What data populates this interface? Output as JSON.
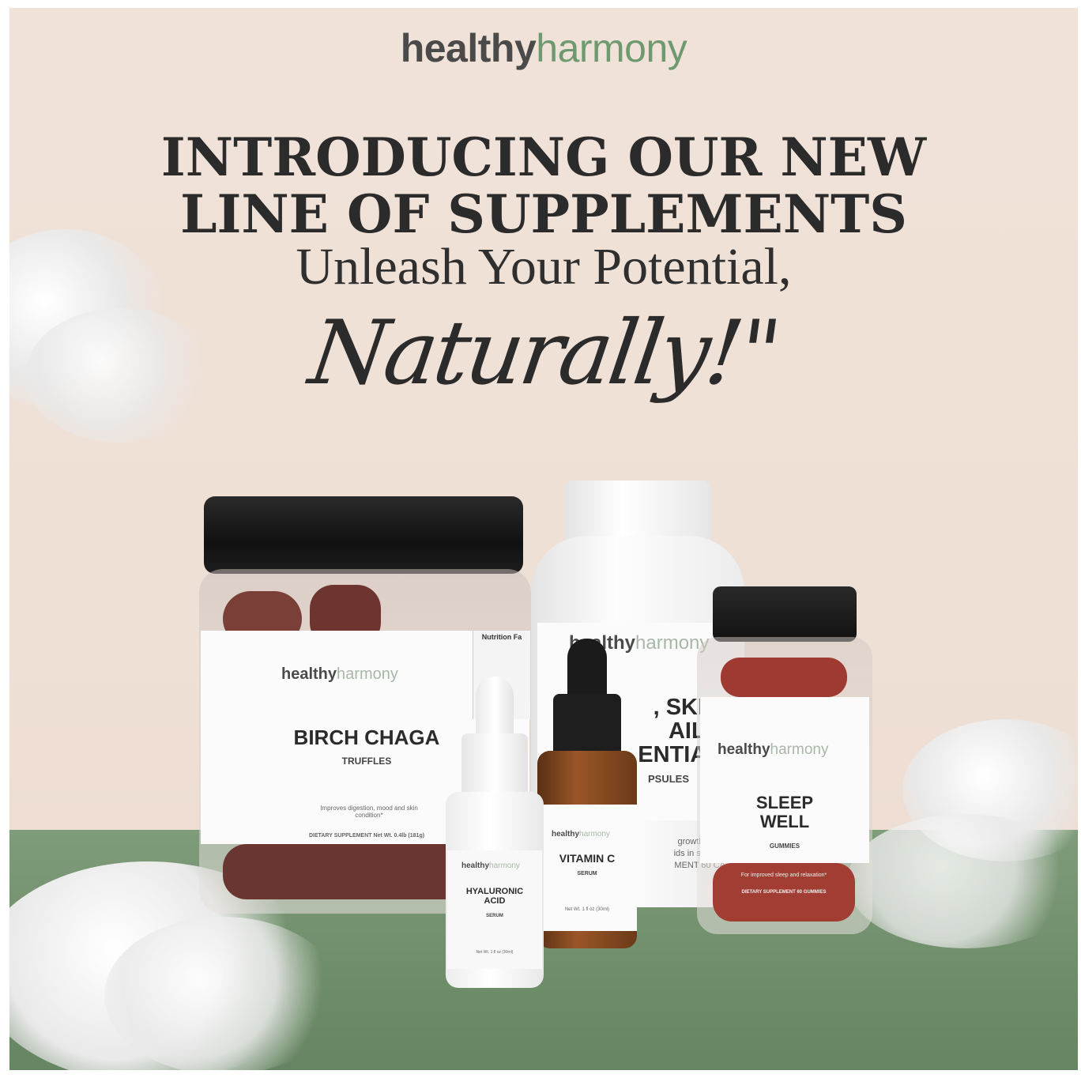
{
  "brand": {
    "bold": "healthy",
    "light": "harmony"
  },
  "headline": {
    "line1": "INTRODUCING OUR NEW",
    "line2": "LINE OF SUPPLEMENTS"
  },
  "tagline": "Unleash Your Potential,",
  "script": "Naturally!\"",
  "products": {
    "jar": {
      "name": "BIRCH CHAGA",
      "sub": "TRUFFLES",
      "desc": "Improves digestion, mood and skin condition*",
      "fine": "DIETARY SUPPLEMENT  Net Wt. 0.4lb (181g)",
      "panel": "Nutrition Fa"
    },
    "bottle": {
      "l1": ", SKIN",
      "l2": "AILS",
      "l3": "ENTIAL",
      "l4": "PSULES",
      "fine1": "growth, impr",
      "fine2": "ids in skin cla",
      "fine3": "MENT  60 CA"
    },
    "gummies": {
      "name1": "SLEEP",
      "name2": "WELL",
      "sub": "GUMMIES",
      "desc": "For improved sleep and relaxation*",
      "fine": "DIETARY SUPPLEMENT  60 GUMMIES"
    },
    "vitc": {
      "name": "VITAMIN C",
      "sub": "SERUM",
      "fine": "Net Wt. 1 fl oz (30ml)"
    },
    "hyal": {
      "name1": "HYALURONIC",
      "name2": "ACID",
      "sub": "SERUM",
      "fine": "Net Wt. 1 fl oz (30ml)"
    }
  },
  "colors": {
    "background": "#efe0d6",
    "ground": "#6e8d69",
    "brand_green": "#6f9a70",
    "text_dark": "#2b2b2b"
  }
}
